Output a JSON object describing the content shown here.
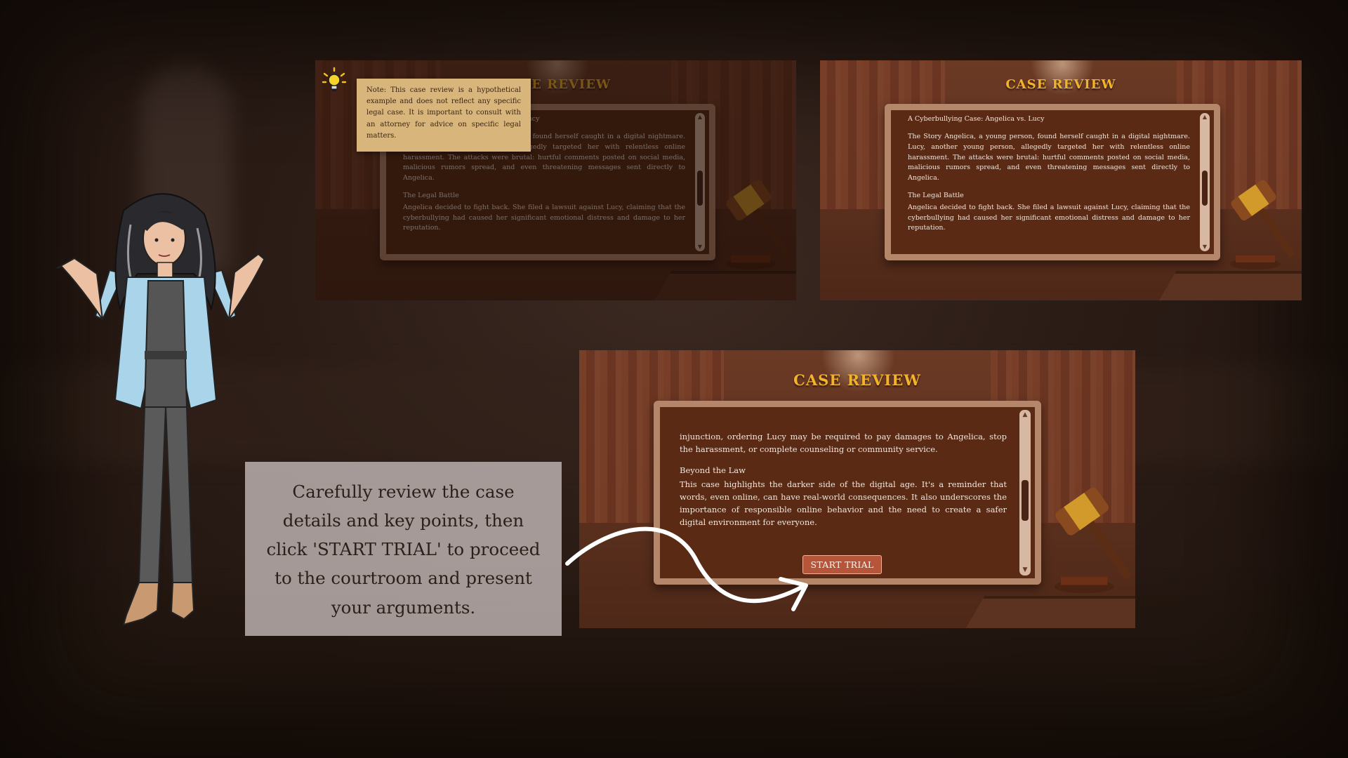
{
  "note": {
    "text": "Note: This case review is a hypothetical example and does not reflect any specific legal case. It is important to consult with an attorney for advice on specific legal matters."
  },
  "slide_small": {
    "title": "CASE REVIEW",
    "heading": "A Cyberbullying Case: Angelica vs. Lucy",
    "paragraph1": "The Story Angelica, a young person, found herself caught in a digital nightmare. Lucy, another young person, allegedly targeted her with relentless online harassment. The attacks were brutal: hurtful comments posted on social media, malicious rumors spread, and even threatening messages sent directly to Angelica.",
    "subheading": "The Legal Battle",
    "paragraph2": "Angelica decided to fight back. She filed a lawsuit against Lucy, claiming that the cyberbullying had caused her significant emotional distress and damage to her reputation."
  },
  "slide_large": {
    "title": "CASE REVIEW",
    "paragraph1": "injunction, ordering Lucy may be required to pay damages to Angelica, stop the harassment, or complete counseling or community service.",
    "subheading": "Beyond the Law",
    "paragraph2": "This case highlights the darker side of the digital age. It's a reminder that words, even online, can have real-world consequences. It also underscores the importance of responsible online behavior and the need to create a safer digital environment for everyone.",
    "start_button": "START TRIAL"
  },
  "instruction": {
    "text": "Carefully review the case details and key points, then click 'START TRIAL' to proceed to the courtroom and present your arguments."
  },
  "colors": {
    "title_gold": "#f3b22b",
    "panel_bg": "#5a2a14",
    "panel_border": "#b5876a",
    "button": "#b5553a",
    "note_bg": "#d8b67b"
  },
  "icons": [
    "lightbulb-icon",
    "gavel-icon",
    "scroll-up-icon",
    "scroll-down-icon",
    "curved-arrow-icon"
  ]
}
